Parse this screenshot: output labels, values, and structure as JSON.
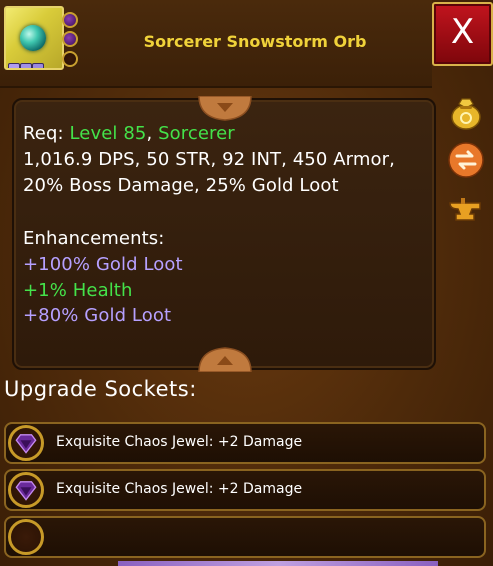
{
  "item": {
    "title": "Sorcerer Snowstorm Orb"
  },
  "close": {
    "label": "X"
  },
  "stats": {
    "req_label": "Req: ",
    "req_level": "Level 85",
    "req_sep": ", ",
    "req_class": "Sorcerer",
    "line1": "1,016.9 DPS, 50 STR, 92 INT, 450 Armor,",
    "line2": "20% Boss Damage, 25% Gold Loot",
    "enh_title": "Enhancements:",
    "enhancements": [
      "+100% Gold Loot",
      "+1% Health",
      "+80% Gold Loot"
    ]
  },
  "upgrade": {
    "title": "Upgrade Sockets:",
    "sockets": [
      {
        "label": "Exquisite Chaos Jewel: +2 Damage",
        "filled": true
      },
      {
        "label": "Exquisite Chaos Jewel: +2 Damage",
        "filled": true
      },
      {
        "label": "",
        "filled": false
      }
    ]
  },
  "icons": {
    "gold_bag": "gold-bag-icon",
    "swap": "swap-icon",
    "anvil": "anvil-icon",
    "orb": "orb-icon",
    "jewel": "chaos-jewel-icon"
  },
  "colors": {
    "title": "#f0d23a",
    "green": "#44e24a",
    "lavender": "#b6a0ff",
    "close_red": "#c2141e"
  }
}
